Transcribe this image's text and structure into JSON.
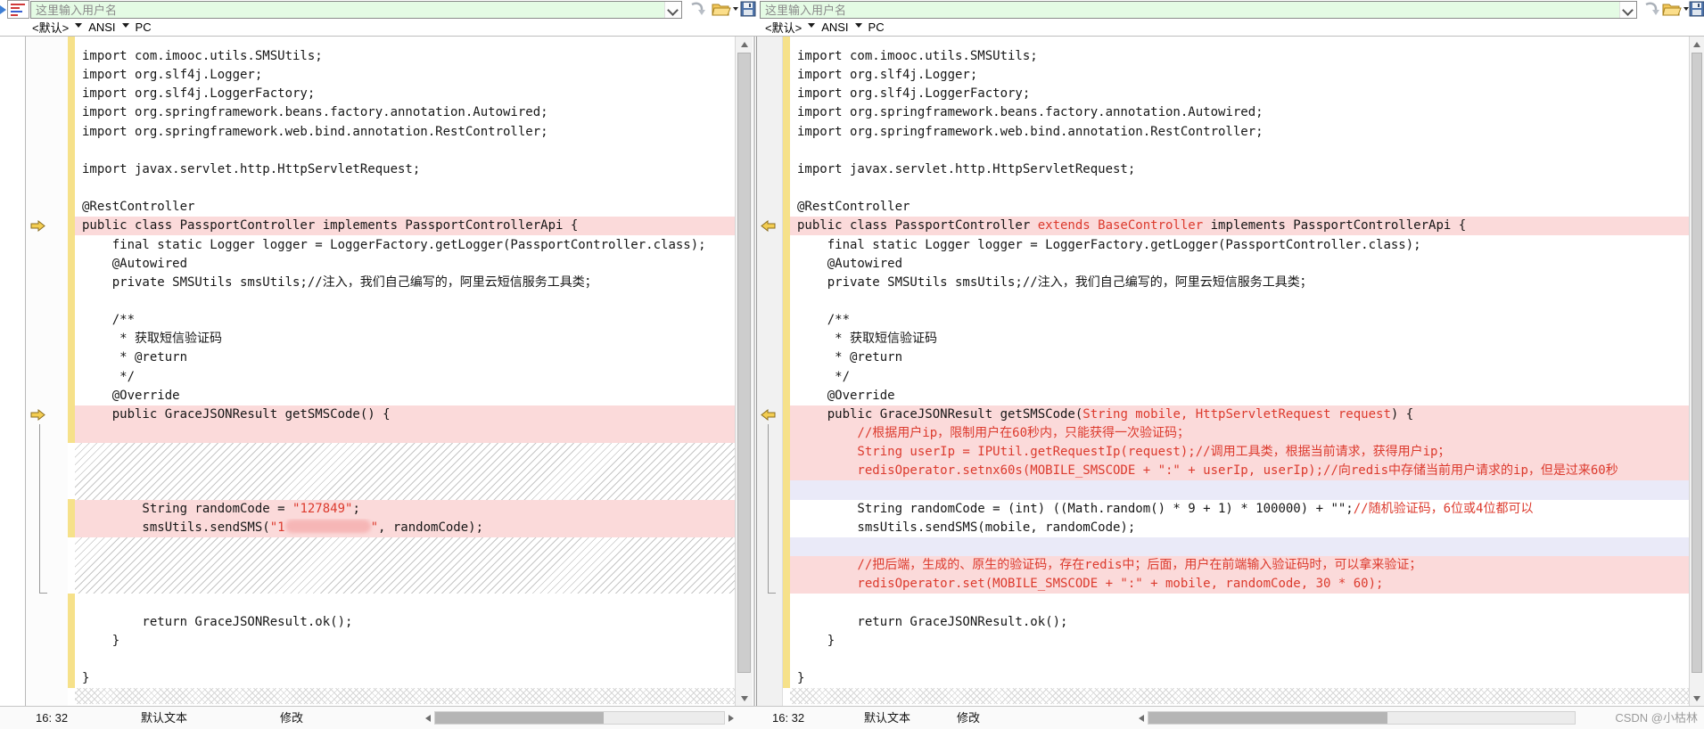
{
  "toolbar": {
    "left_input_placeholder": "这里输入用户名",
    "right_input_placeholder": "这里输入用户名",
    "left_ruleset": "<默认>",
    "left_encoding": "ANSI",
    "left_platform": "PC",
    "right_ruleset": "<默认>",
    "right_encoding": "ANSI",
    "right_platform": "PC"
  },
  "colors": {
    "diff_highlight_pink": "#fbdada",
    "changed_text_red": "#dc3a2d",
    "missing_blank_lavender": "#eaeaf8",
    "change_bar_yellow": "#f6e18a",
    "input_green": "#e4fbe4"
  },
  "status": {
    "left": {
      "position": "16: 32",
      "mode": "默认文本",
      "state": "修改"
    },
    "right": {
      "position": "16: 32",
      "mode": "默认文本",
      "state": "修改"
    },
    "watermark": "CSDN @小枯林"
  },
  "panes": {
    "left": {
      "rows": [
        {
          "segs": [
            [
              "k",
              "import com.imooc.utils.SMSUtils;"
            ]
          ]
        },
        {
          "segs": [
            [
              "k",
              "import org.slf4j.Logger;"
            ]
          ]
        },
        {
          "segs": [
            [
              "k",
              "import org.slf4j.LoggerFactory;"
            ]
          ]
        },
        {
          "segs": [
            [
              "k",
              "import org.springframework.beans.factory.annotation.Autowired;"
            ]
          ]
        },
        {
          "segs": [
            [
              "k",
              "import org.springframework.web.bind.annotation.RestController;"
            ]
          ]
        },
        {},
        {
          "segs": [
            [
              "k",
              "import javax.servlet.http.HttpServletRequest;"
            ]
          ]
        },
        {},
        {
          "segs": [
            [
              "k",
              "@RestController"
            ]
          ]
        },
        {
          "bg": "pink",
          "arrow": true,
          "segs": [
            [
              "k",
              "public class PassportController implements PassportControllerApi {"
            ]
          ]
        },
        {
          "segs": [
            [
              "k",
              "    final static Logger logger = LoggerFactory.getLogger(PassportController.class);"
            ]
          ]
        },
        {
          "segs": [
            [
              "k",
              "    @Autowired"
            ]
          ]
        },
        {
          "segs": [
            [
              "k",
              "    private SMSUtils smsUtils;//注入，我们自己编写的，阿里云短信服务工具类；"
            ]
          ]
        },
        {},
        {
          "segs": [
            [
              "k",
              "    /**"
            ]
          ]
        },
        {
          "segs": [
            [
              "k",
              "     * 获取短信验证码"
            ]
          ]
        },
        {
          "segs": [
            [
              "k",
              "     * @return"
            ]
          ]
        },
        {
          "segs": [
            [
              "k",
              "     */"
            ]
          ]
        },
        {
          "segs": [
            [
              "k",
              "    @Override"
            ]
          ]
        },
        {
          "bg": "pink",
          "arrow": true,
          "segs": [
            [
              "k",
              "    public GraceJSONResult getSMSCode() {"
            ]
          ]
        },
        {
          "bg": "pink"
        },
        {
          "bg": "hatch",
          "n": 3
        },
        {
          "bg": "pink",
          "segs": [
            [
              "k",
              "        String randomCode = "
            ],
            [
              "r",
              "\"127849\""
            ],
            [
              "k",
              ";"
            ]
          ]
        },
        {
          "bg": "pink",
          "segs": [
            [
              "k",
              "        smsUtils.sendSMS("
            ],
            [
              "r",
              "\"1"
            ],
            [
              "blur",
              ""
            ],
            [
              "r",
              "\""
            ],
            [
              "k",
              ", randomCode);"
            ]
          ]
        },
        {
          "bg": "hatch",
          "n": 3
        },
        {},
        {
          "segs": [
            [
              "k",
              "        return GraceJSONResult.ok();"
            ]
          ]
        },
        {
          "segs": [
            [
              "k",
              "    }"
            ]
          ]
        },
        {},
        {
          "segs": [
            [
              "k",
              "}"
            ]
          ]
        },
        {
          "bg": "eof"
        }
      ]
    },
    "right": {
      "rows": [
        {
          "segs": [
            [
              "k",
              "import com.imooc.utils.SMSUtils;"
            ]
          ]
        },
        {
          "segs": [
            [
              "k",
              "import org.slf4j.Logger;"
            ]
          ]
        },
        {
          "segs": [
            [
              "k",
              "import org.slf4j.LoggerFactory;"
            ]
          ]
        },
        {
          "segs": [
            [
              "k",
              "import org.springframework.beans.factory.annotation.Autowired;"
            ]
          ]
        },
        {
          "segs": [
            [
              "k",
              "import org.springframework.web.bind.annotation.RestController;"
            ]
          ]
        },
        {},
        {
          "segs": [
            [
              "k",
              "import javax.servlet.http.HttpServletRequest;"
            ]
          ]
        },
        {},
        {
          "segs": [
            [
              "k",
              "@RestController"
            ]
          ]
        },
        {
          "bg": "pink",
          "arrow": true,
          "segs": [
            [
              "k",
              "public class PassportController "
            ],
            [
              "r",
              "extends BaseController "
            ],
            [
              "k",
              "implements PassportControllerApi {"
            ]
          ]
        },
        {
          "segs": [
            [
              "k",
              "    final static Logger logger = LoggerFactory.getLogger(PassportController.class);"
            ]
          ]
        },
        {
          "segs": [
            [
              "k",
              "    @Autowired"
            ]
          ]
        },
        {
          "segs": [
            [
              "k",
              "    private SMSUtils smsUtils;//注入，我们自己编写的，阿里云短信服务工具类；"
            ]
          ]
        },
        {},
        {
          "segs": [
            [
              "k",
              "    /**"
            ]
          ]
        },
        {
          "segs": [
            [
              "k",
              "     * 获取短信验证码"
            ]
          ]
        },
        {
          "segs": [
            [
              "k",
              "     * @return"
            ]
          ]
        },
        {
          "segs": [
            [
              "k",
              "     */"
            ]
          ]
        },
        {
          "segs": [
            [
              "k",
              "    @Override"
            ]
          ]
        },
        {
          "bg": "pink",
          "arrow": true,
          "segs": [
            [
              "k",
              "    public GraceJSONResult getSMSCode("
            ],
            [
              "r",
              "String mobile, HttpServletRequest request"
            ],
            [
              "k",
              ") {"
            ]
          ]
        },
        {
          "bg": "pink",
          "segs": [
            [
              "r",
              "        //根据用户ip，限制用户在60秒内，只能获得一次验证码；"
            ]
          ]
        },
        {
          "bg": "pink",
          "segs": [
            [
              "r",
              "        String userIp = IPUtil.getRequestIp(request);//调用工具类，根据当前请求，获得用户ip；"
            ]
          ]
        },
        {
          "bg": "pink",
          "segs": [
            [
              "r",
              "        redisOperator.setnx60s(MOBILE_SMSCODE + \":\" + userIp, userIp);//向redis中存储当前用户请求的ip，但是过来60秒"
            ]
          ]
        },
        {
          "bg": "lav"
        },
        {
          "segs": [
            [
              "k",
              "        String randomCode = (int) ((Math.random() * 9 + 1) * 100000) + \"\";"
            ],
            [
              "r",
              "//随机验证码，6位或4位都可以"
            ]
          ]
        },
        {
          "segs": [
            [
              "k",
              "        smsUtils.sendSMS(mobile, randomCode);"
            ]
          ]
        },
        {
          "bg": "lav"
        },
        {
          "bg": "pink",
          "segs": [
            [
              "r",
              "        //把后端，生成的、原生的验证码，存在redis中；后面，用户在前端输入验证码时，可以拿来验证；"
            ]
          ]
        },
        {
          "bg": "pink",
          "segs": [
            [
              "r",
              "        redisOperator.set(MOBILE_SMSCODE + \":\" + mobile, randomCode, 30 * 60);"
            ]
          ]
        },
        {},
        {
          "segs": [
            [
              "k",
              "        return GraceJSONResult.ok();"
            ]
          ]
        },
        {
          "segs": [
            [
              "k",
              "    }"
            ]
          ]
        },
        {},
        {
          "segs": [
            [
              "k",
              "}"
            ]
          ]
        },
        {
          "bg": "eof"
        }
      ]
    }
  }
}
